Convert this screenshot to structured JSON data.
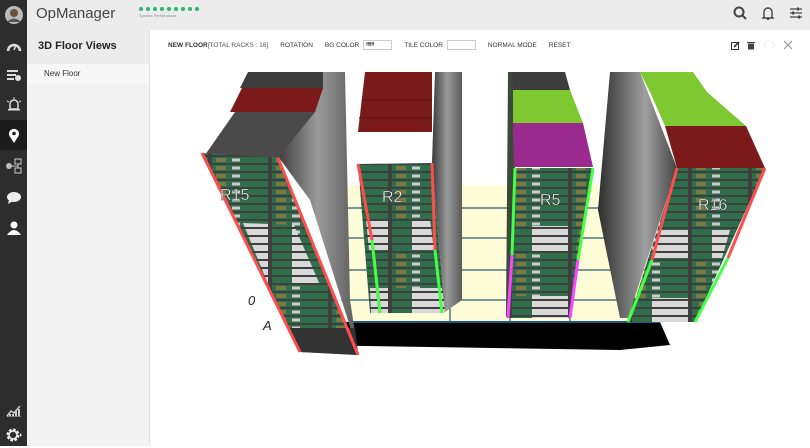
{
  "app": {
    "title": "OpManager",
    "performance_label": "System Performance"
  },
  "sidebar": {
    "items": [
      {
        "icon": "dashboard-gauge-icon"
      },
      {
        "icon": "inventory-list-icon"
      },
      {
        "icon": "alarm-icon"
      },
      {
        "icon": "map-pin-icon",
        "active": true
      },
      {
        "icon": "network-icon"
      },
      {
        "icon": "chat-icon"
      },
      {
        "icon": "user-icon"
      },
      {
        "icon": "reports-chart-icon"
      },
      {
        "icon": "settings-gear-icon"
      }
    ]
  },
  "left_panel": {
    "title": "3D Floor Views",
    "items": [
      "New Floor"
    ]
  },
  "toolbar": {
    "floor_name": "NEW FLOOR",
    "total_racks": "[TOTAL RACKS : 16]",
    "rotation": "ROTATION",
    "bg_color_label": "BG COLOR",
    "bg_color_value": "ffffff",
    "tile_color_label": "TILE COLOR",
    "tile_color_value": "",
    "mode": "NORMAL MODE",
    "reset": "RESET"
  },
  "scene": {
    "racks": [
      "R15",
      "R2",
      "R5",
      "R16"
    ],
    "row_label": "0",
    "column_label": "A"
  },
  "colors": {
    "sidebar": "#2d2d2d",
    "accent_green": "#2bb673",
    "critical": "#ff4d4d",
    "clear": "#44ff44",
    "attention": "#ff44ff",
    "tile": "#fffdd8"
  }
}
